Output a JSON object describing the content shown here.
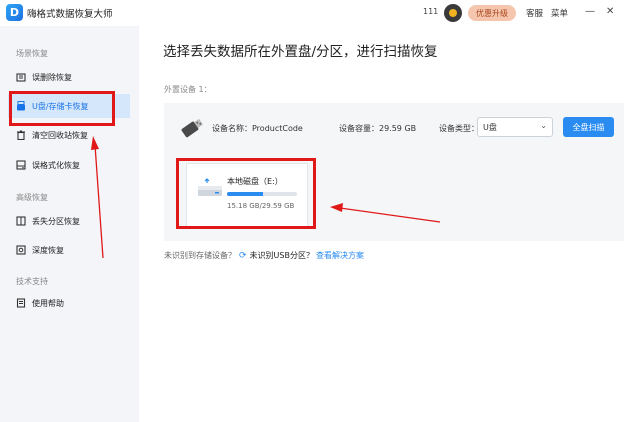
{
  "app": {
    "title": "嗨格式数据恢复大师",
    "logo_letter": "D",
    "user_id": "111",
    "upgrade_label": "优惠升级",
    "help_label": "客服",
    "menu_label": "菜单",
    "minimize": "—",
    "close": "✕"
  },
  "sidebar": {
    "sections": [
      {
        "label": "场景恢复",
        "items": [
          {
            "label": "误删除恢复",
            "icon": "trash-restore-icon",
            "active": false
          },
          {
            "label": "U盘/存储卡恢复",
            "icon": "usb-drive-icon",
            "active": true
          },
          {
            "label": "清空回收站恢复",
            "icon": "recycle-bin-icon",
            "active": false
          },
          {
            "label": "误格式化恢复",
            "icon": "format-disk-icon",
            "active": false
          }
        ]
      },
      {
        "label": "高级恢复",
        "items": [
          {
            "label": "丢失分区恢复",
            "icon": "partition-icon",
            "active": false
          },
          {
            "label": "深度恢复",
            "icon": "deep-scan-icon",
            "active": false
          }
        ]
      },
      {
        "label": "技术支持",
        "items": [
          {
            "label": "使用帮助",
            "icon": "help-book-icon",
            "active": false
          }
        ]
      }
    ]
  },
  "main": {
    "title": "选择丢失数据所在外置盘/分区，进行扫描恢复",
    "external_label": "外置设备 1：",
    "device": {
      "name_label": "设备名称：ProductCode",
      "capacity_label": "设备容量：29.59 GB",
      "type_label": "设备类型：",
      "type_value": "U盘",
      "scan_all": "全盘扫描"
    },
    "partition": {
      "name": "本地磁盘（E:）",
      "size": "15.18 GB/29.59 GB",
      "used_fraction": 0.513
    },
    "bottom": {
      "question1": "未识别到存储设备？",
      "question2": "未识别USB分区？",
      "link": "查看解决方案"
    }
  },
  "colors": {
    "accent": "#2a8cf0",
    "annotation_red": "#e01818",
    "sidebar_bg": "#f3f5f8",
    "active_bg": "#d5e7fb"
  }
}
